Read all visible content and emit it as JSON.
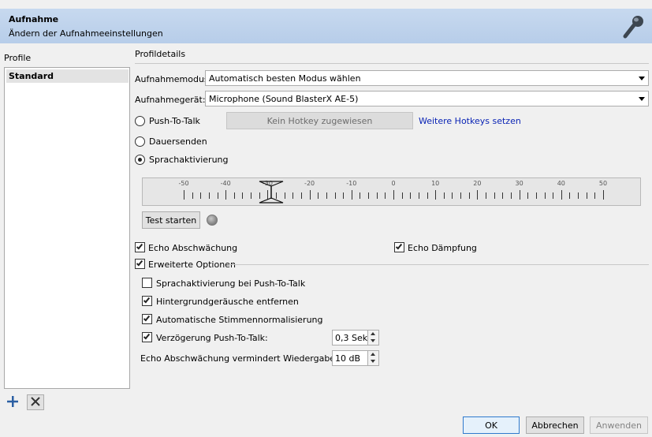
{
  "header": {
    "title": "Aufnahme",
    "subtitle": "Ändern der Aufnahmeeinstellungen",
    "icon": "microphone-icon"
  },
  "profiles": {
    "label": "Profile",
    "items": [
      {
        "label": "Standard",
        "selected": true
      }
    ],
    "add_icon": "plus-icon",
    "remove_icon": "close-icon"
  },
  "details": {
    "title": "Profildetails",
    "mode_label": "Aufnahmemodus:",
    "mode_value": "Automatisch besten Modus wählen",
    "device_label": "Aufnahmegerät:",
    "device_value": "Microphone (Sound BlasterX AE-5)",
    "ptt_label": "Push-To-Talk",
    "hotkey_button": "Kein Hotkey zugewiesen",
    "more_hotkeys": "Weitere Hotkeys setzen",
    "continuous_label": "Dauersenden",
    "voice_activation_label": "Sprachaktivierung",
    "selected_mode": "Sprachaktivierung",
    "meter": {
      "scale": [
        "-50",
        "-40",
        "-30",
        "-20",
        "-10",
        "0",
        "10",
        "20",
        "30",
        "40",
        "50"
      ],
      "threshold": -30
    },
    "test_button": "Test starten",
    "echo_reduction_label": "Echo Abschwächung",
    "echo_reduction_checked": true,
    "echo_cancel_label": "Echo Dämpfung",
    "echo_cancel_checked": true,
    "advanced_label": "Erweiterte Optionen",
    "advanced_checked": true,
    "adv_voice_on_ptt_label": "Sprachaktivierung bei Push-To-Talk",
    "adv_voice_on_ptt_checked": false,
    "adv_noise_label": "Hintergrundgeräusche entfernen",
    "adv_noise_checked": true,
    "adv_normalize_label": "Automatische Stimmennormalisierung",
    "adv_normalize_checked": true,
    "adv_delay_label": "Verzögerung Push-To-Talk:",
    "adv_delay_checked": true,
    "adv_delay_value": "0,3 Sek",
    "echo_reduce_playback_label": "Echo Abschwächung vermindert Wiedergabe um:",
    "echo_reduce_playback_value": "10 dB"
  },
  "footer": {
    "ok": "OK",
    "cancel": "Abbrechen",
    "apply": "Anwenden"
  }
}
